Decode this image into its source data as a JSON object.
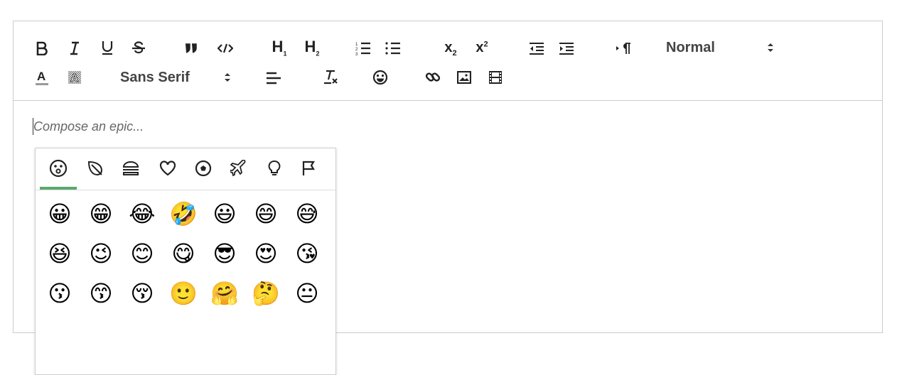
{
  "toolbar": {
    "row1": {
      "bold_icon": "bold-icon",
      "italic_icon": "italic-icon",
      "underline_icon": "underline-icon",
      "strike_icon": "strikethrough-icon",
      "blockquote_icon": "blockquote-icon",
      "code_icon": "code-block-icon",
      "h1_icon": "header-1-icon",
      "h2_icon": "header-2-icon",
      "ol_icon": "ordered-list-icon",
      "ul_icon": "bullet-list-icon",
      "sub_icon": "subscript-icon",
      "sup_icon": "superscript-icon",
      "outdent_icon": "outdent-icon",
      "indent_icon": "indent-icon",
      "direction_icon": "text-direction-icon",
      "size_label": "Normal"
    },
    "row2": {
      "color_icon": "font-color-icon",
      "background_icon": "background-color-icon",
      "font_label": "Sans Serif",
      "align_icon": "align-icon",
      "clean_icon": "clear-format-icon",
      "emoji_icon": "emoji-icon",
      "link_icon": "link-icon",
      "image_icon": "image-icon",
      "video_icon": "video-icon"
    },
    "sub_label": "x",
    "sub_num": "2",
    "sup_num": "2",
    "h1_num": "1",
    "h2_num": "2"
  },
  "editor": {
    "placeholder": "Compose an epic..."
  },
  "emoji_palette": {
    "accent_color": "#5aa96b",
    "tabs": [
      {
        "name": "people-tab",
        "icon": "smiley-face-icon",
        "active": true
      },
      {
        "name": "nature-tab",
        "icon": "leaf-icon",
        "active": false
      },
      {
        "name": "food-tab",
        "icon": "burger-icon",
        "active": false
      },
      {
        "name": "symbols-tab",
        "icon": "heart-icon",
        "active": false
      },
      {
        "name": "activity-tab",
        "icon": "soccer-ball-icon",
        "active": false
      },
      {
        "name": "travel-tab",
        "icon": "airplane-icon",
        "active": false
      },
      {
        "name": "objects-tab",
        "icon": "lightbulb-icon",
        "active": false
      },
      {
        "name": "flags-tab",
        "icon": "flag-icon",
        "active": false
      }
    ],
    "emojis": [
      [
        "😀",
        "😁",
        "😂",
        "🤣",
        "😃",
        "😄",
        "😅"
      ],
      [
        "😆",
        "😉",
        "😊",
        "😋",
        "😎",
        "😍",
        "😘"
      ],
      [
        "😗",
        "😙",
        "😚",
        "🙂",
        "🤗",
        "🤔",
        "😐"
      ]
    ]
  }
}
